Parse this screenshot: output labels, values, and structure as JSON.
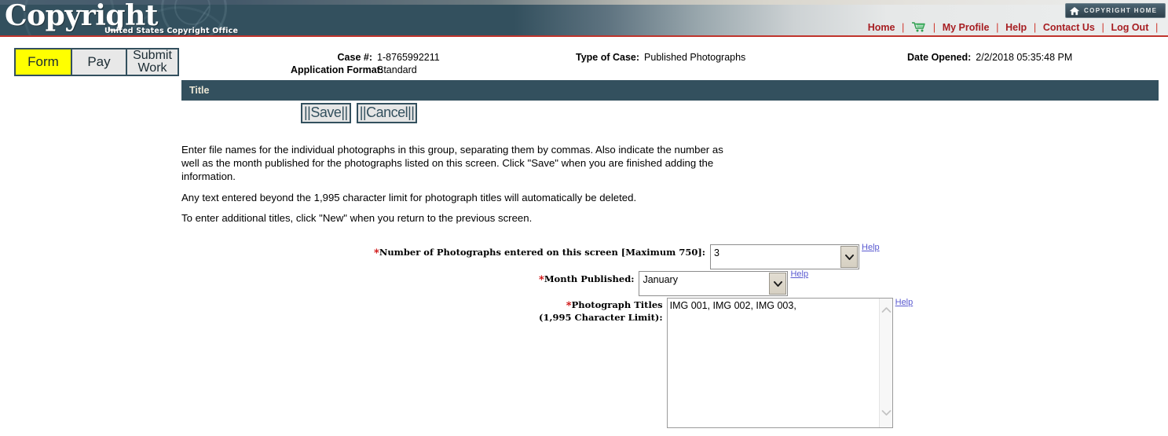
{
  "banner": {
    "logo_text": "Copyright",
    "logo_subtitle": "United States Copyright Office",
    "home_button_label": "COPYRIGHT HOME",
    "home_icon": "house-icon"
  },
  "nav": {
    "items": [
      {
        "label": "Home",
        "icon": null
      },
      {
        "label": "",
        "icon": "shopping-cart-icon"
      },
      {
        "label": "My Profile",
        "icon": null
      },
      {
        "label": "Help",
        "icon": null
      },
      {
        "label": "Contact Us",
        "icon": null
      },
      {
        "label": "Log Out",
        "icon": null
      }
    ],
    "separator": "|",
    "link_color": "#a71e22"
  },
  "tabs": [
    {
      "label": "Form",
      "active": true
    },
    {
      "label": "Pay",
      "active": false
    },
    {
      "label": "Submit Work",
      "active": false
    }
  ],
  "case_info": {
    "case_number_label": "Case #:",
    "case_number_value": "1-8765992211",
    "application_format_label": "Application Format:",
    "application_format_value": "Standard",
    "type_of_case_label": "Type of Case:",
    "type_of_case_value": "Published Photographs",
    "date_opened_label": "Date Opened:",
    "date_opened_value": "2/2/2018 05:35:48 PM"
  },
  "section": {
    "title": "Title",
    "title_bar_color": "#33505e"
  },
  "actions": {
    "save_label": "||Save||",
    "cancel_label": "||Cancel||"
  },
  "instructions": {
    "p1": "Enter file names for the individual photographs in this group, separating them by commas. Also indicate the number as well as the month published for the photographs listed on this screen. Click \"Save\" when you are finished adding the information.",
    "p2": "Any text entered beyond the 1,995 character limit for photograph titles will automatically be deleted.",
    "p3": "To enter additional titles, click \"New\" when you return to the previous screen."
  },
  "form": {
    "number_of_photographs": {
      "label": "Number of Photographs entered on this screen [Maximum 750]:",
      "value": "3",
      "required": true,
      "help_label": "Help"
    },
    "month_published": {
      "label": "Month Published:",
      "value": "January",
      "required": true,
      "help_label": "Help"
    },
    "photograph_titles": {
      "label_line1": "Photograph Titles",
      "label_line2": "(1,995 Character Limit):",
      "value": "IMG 001, IMG 002, IMG 003,",
      "required": true,
      "help_label": "Help"
    }
  },
  "colors": {
    "banner_dark": "#33505e",
    "accent_red": "#c0342c",
    "active_tab": "#ffff00",
    "required_star": "#cc0000",
    "help_link": "#5a5ad0"
  }
}
